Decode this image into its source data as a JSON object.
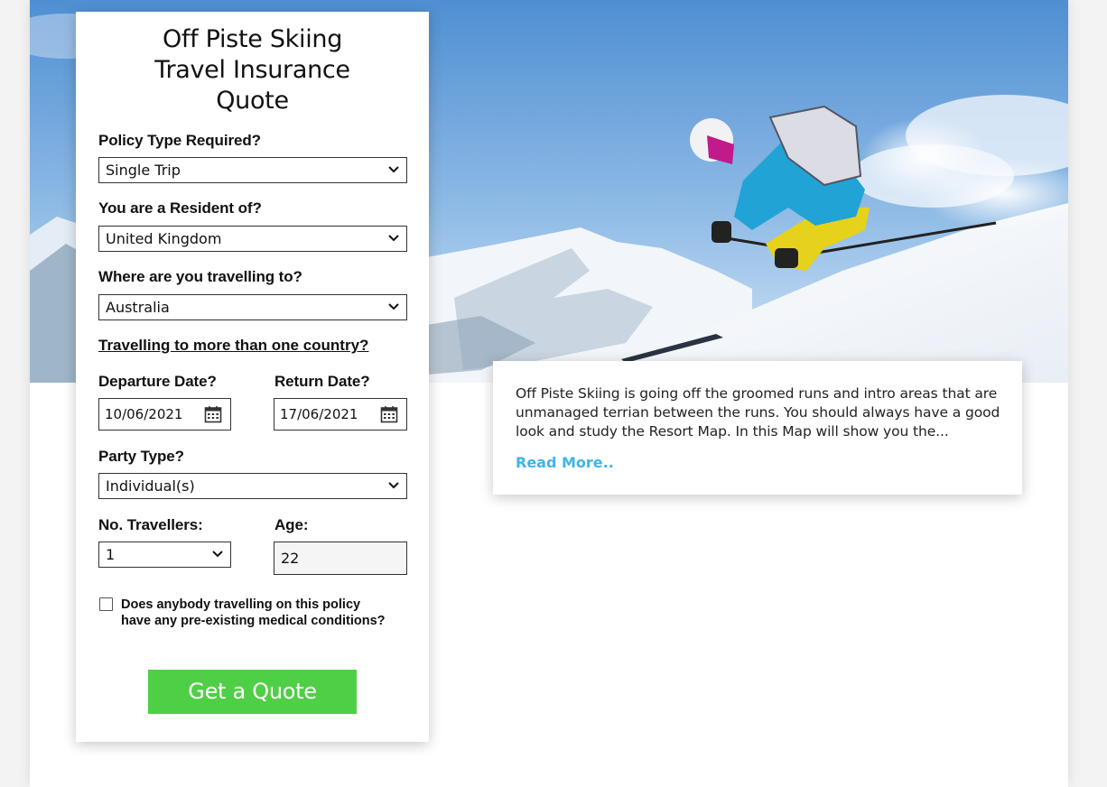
{
  "quote_form": {
    "title_lines": [
      "Off Piste Skiing",
      "Travel Insurance",
      "Quote"
    ],
    "policy_type": {
      "label": "Policy Type Required?",
      "value": "Single Trip"
    },
    "residence": {
      "label": "You are a Resident of?",
      "value": "United Kingdom"
    },
    "destination": {
      "label": "Where are you travelling to?",
      "value": "Australia"
    },
    "multi_country_link": "Travelling to more than one country?",
    "departure": {
      "label": "Departure Date?",
      "value": "10/06/2021"
    },
    "return": {
      "label": "Return Date?",
      "value": "17/06/2021"
    },
    "party_type": {
      "label": "Party Type?",
      "value": "Individual(s)"
    },
    "travellers": {
      "label": "No. Travellers:",
      "value": "1"
    },
    "age": {
      "label": "Age:",
      "value": "22"
    },
    "medical_checkbox": {
      "label": "Does anybody travelling on this policy have any pre-existing medical conditions?",
      "checked": false
    },
    "submit_label": "Get a Quote"
  },
  "info_card": {
    "text": "Off Piste Skiing is going off the groomed runs and intro areas that are unmanaged terrian between the runs. You should always have a good look and study the Resort Map. In this Map will show you the...",
    "read_more": "Read More.."
  },
  "colors": {
    "button_green": "#4fcf45",
    "link_blue": "#3fb4e8",
    "sky_blue": "#5f9fd8"
  },
  "icons": [
    "chevron-down-icon",
    "calendar-icon"
  ]
}
